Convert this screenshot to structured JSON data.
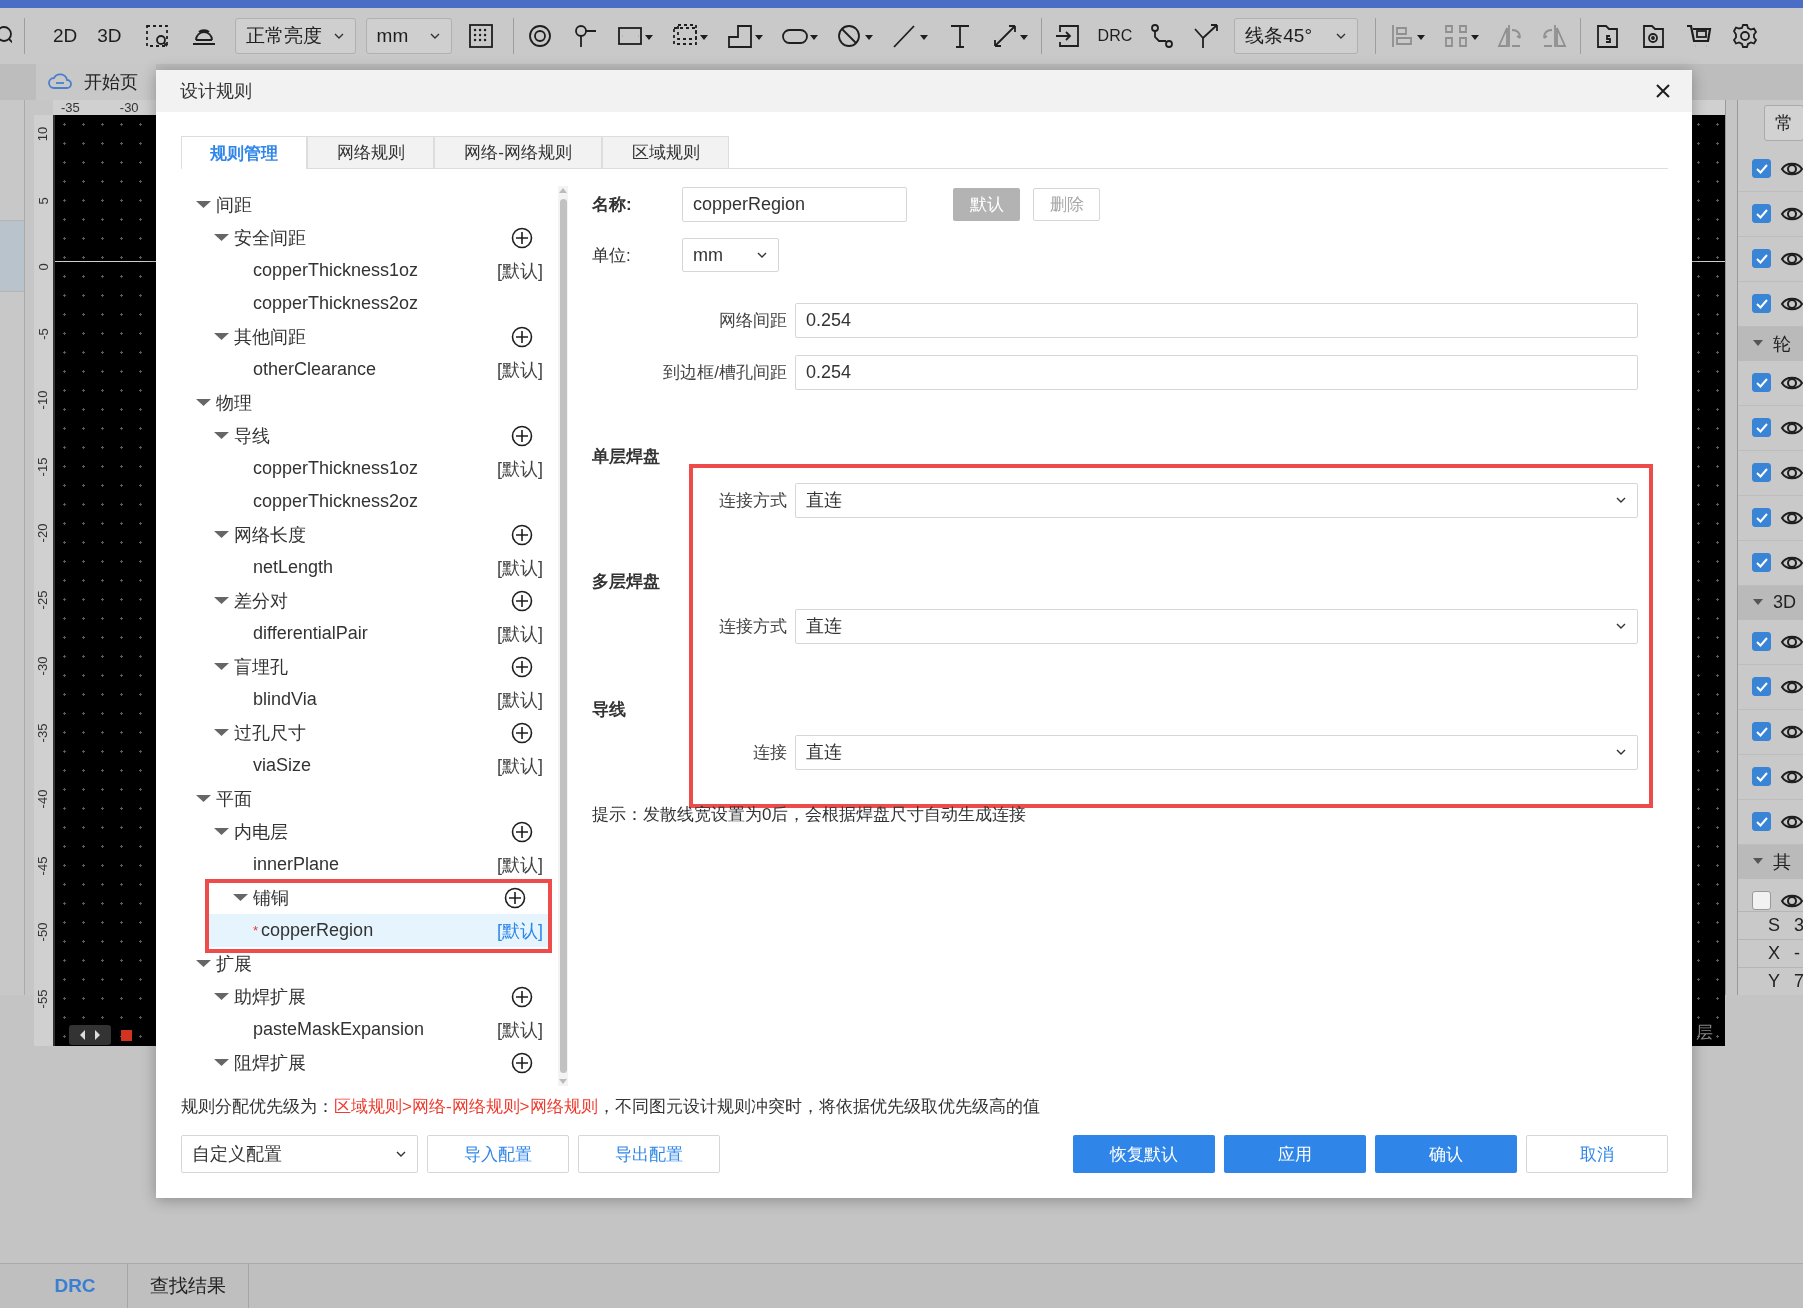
{
  "toolbar": {
    "view_2d": "2D",
    "view_3d": "3D",
    "brightness": "正常亮度",
    "unit": "mm",
    "drc": "DRC",
    "route_mode": "线条45°"
  },
  "document_tabs": [
    {
      "label": "开始页",
      "selected": false
    }
  ],
  "ruler": {
    "horizontal": [
      "-35",
      "-30"
    ],
    "vertical": [
      "10",
      "5",
      "0",
      "-5",
      "-10",
      "-15",
      "-20",
      "-25",
      "-30",
      "-35",
      "-40",
      "-45",
      "-50",
      "-55"
    ]
  },
  "status_fragment": "层",
  "right_panel": {
    "tab": "常",
    "items": [
      {
        "kind": "layer",
        "checked": true
      },
      {
        "kind": "layer",
        "checked": true
      },
      {
        "kind": "layer",
        "checked": true
      },
      {
        "kind": "layer",
        "checked": true
      },
      {
        "kind": "group",
        "label": "轮",
        "expanded": true
      },
      {
        "kind": "layer",
        "checked": true
      },
      {
        "kind": "layer",
        "checked": true
      },
      {
        "kind": "layer",
        "checked": true
      },
      {
        "kind": "layer",
        "checked": true
      },
      {
        "kind": "layer",
        "checked": true
      },
      {
        "kind": "group",
        "label": "3D",
        "expanded": true
      },
      {
        "kind": "layer",
        "checked": true
      },
      {
        "kind": "layer",
        "checked": true
      },
      {
        "kind": "layer",
        "checked": true
      },
      {
        "kind": "layer",
        "checked": true
      },
      {
        "kind": "layer",
        "checked": true
      },
      {
        "kind": "group",
        "label": "其",
        "expanded": true
      },
      {
        "kind": "layer",
        "checked": false
      }
    ],
    "coordinates": [
      {
        "axis": "S",
        "value": "3"
      },
      {
        "axis": "X",
        "value": "-"
      },
      {
        "axis": "Y",
        "value": "7"
      }
    ]
  },
  "dialog": {
    "title": "设计规则",
    "tabs": [
      {
        "label": "规则管理",
        "selected": true
      },
      {
        "label": "网络规则",
        "selected": false
      },
      {
        "label": "网络-网络规则",
        "selected": false
      },
      {
        "label": "区域规则",
        "selected": false
      }
    ],
    "tree": [
      {
        "label": "间距",
        "expanded": true,
        "selected": false,
        "children": [
          {
            "label": "安全间距",
            "expanded": true,
            "selected": false,
            "children": [
              {
                "label": "copperThickness1oz",
                "tag": "[默认]",
                "selected": false
              },
              {
                "label": "copperThickness2oz",
                "selected": false
              }
            ]
          },
          {
            "label": "其他间距",
            "expanded": true,
            "selected": false,
            "children": [
              {
                "label": "otherClearance",
                "tag": "[默认]",
                "selected": false
              }
            ]
          }
        ]
      },
      {
        "label": "物理",
        "expanded": true,
        "selected": false,
        "children": [
          {
            "label": "导线",
            "expanded": true,
            "selected": false,
            "children": [
              {
                "label": "copperThickness1oz",
                "tag": "[默认]",
                "selected": false
              },
              {
                "label": "copperThickness2oz",
                "selected": false
              }
            ]
          },
          {
            "label": "网络长度",
            "expanded": true,
            "selected": false,
            "children": [
              {
                "label": "netLength",
                "tag": "[默认]",
                "selected": false
              }
            ]
          },
          {
            "label": "差分对",
            "expanded": true,
            "selected": false,
            "children": [
              {
                "label": "differentialPair",
                "tag": "[默认]",
                "selected": false
              }
            ]
          },
          {
            "label": "盲埋孔",
            "expanded": true,
            "selected": false,
            "children": [
              {
                "label": "blindVia",
                "tag": "[默认]",
                "selected": false
              }
            ]
          },
          {
            "label": "过孔尺寸",
            "expanded": true,
            "selected": false,
            "children": [
              {
                "label": "viaSize",
                "tag": "[默认]",
                "selected": false
              }
            ]
          }
        ]
      },
      {
        "label": "平面",
        "expanded": true,
        "selected": false,
        "children": [
          {
            "label": "内电层",
            "expanded": true,
            "selected": false,
            "children": [
              {
                "label": "innerPlane",
                "tag": "[默认]",
                "selected": false
              }
            ]
          },
          {
            "label": "铺铜",
            "expanded": true,
            "selected": false,
            "highlighted": true,
            "children": [
              {
                "label": "copperRegion",
                "mark": "*",
                "tag": "[默认]",
                "selected": true
              }
            ]
          }
        ]
      },
      {
        "label": "扩展",
        "expanded": true,
        "selected": false,
        "children": [
          {
            "label": "助焊扩展",
            "expanded": true,
            "selected": false,
            "children": [
              {
                "label": "pasteMaskExpansion",
                "tag": "[默认]",
                "selected": false
              }
            ]
          },
          {
            "label": "阻焊扩展",
            "expanded": true,
            "selected": false
          }
        ]
      }
    ],
    "form": {
      "name_label": "名称:",
      "name": "copperRegion",
      "name_buttons": [
        {
          "label": "默认",
          "kind": "primary",
          "disabled": true
        },
        {
          "label": "删除",
          "kind": "secondary",
          "disabled": true
        }
      ],
      "unit_label": "单位:",
      "unit": "mm",
      "fields": [
        {
          "label": "网络间距",
          "value": "0.254"
        },
        {
          "label": "到边框/槽孔间距",
          "value": "0.254"
        }
      ],
      "pad_settings": {
        "highlighted": true,
        "sections": [
          {
            "title": "单层焊盘",
            "label": "连接方式",
            "value": "直连"
          },
          {
            "title": "多层焊盘",
            "label": "连接方式",
            "value": "直连"
          },
          {
            "title": "导线",
            "label": "连接",
            "value": "直连"
          }
        ]
      },
      "hint": "提示：发散线宽设置为0后，会根据焊盘尺寸自动生成连接"
    },
    "priority": {
      "prefix": "规则分配优先级为：",
      "order": "区域规则>网络-网络规则>网络规则",
      "suffix": "，不同图元设计规则冲突时，将依据优先级取优先级高的值"
    },
    "config": "自定义配置",
    "config_buttons": [
      {
        "label": "导入配置",
        "kind": "secondary"
      },
      {
        "label": "导出配置",
        "kind": "secondary"
      }
    ],
    "action_buttons": [
      {
        "label": "恢复默认",
        "kind": "primary"
      },
      {
        "label": "应用",
        "kind": "primary"
      },
      {
        "label": "确认",
        "kind": "primary"
      },
      {
        "label": "取消",
        "kind": "secondary"
      }
    ]
  },
  "bottom_tabs": [
    {
      "label": "DRC",
      "selected": true
    },
    {
      "label": "查找结果",
      "selected": false
    }
  ]
}
